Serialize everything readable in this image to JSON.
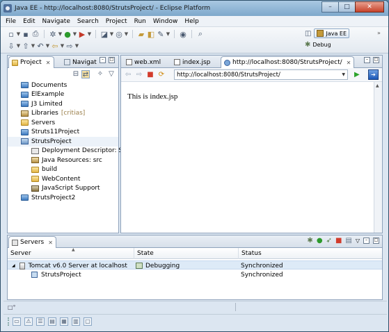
{
  "window": {
    "title": "Java EE - http://localhost:8080/StrutsProject/ - Eclipse Platform",
    "minimize": "–",
    "maximize": "□",
    "close": "✕"
  },
  "menu": [
    "File",
    "Edit",
    "Navigate",
    "Search",
    "Project",
    "Run",
    "Window",
    "Help"
  ],
  "perspectives": {
    "active_label": "Java EE",
    "other_label": "Debug",
    "overflow": "»"
  },
  "project_explorer": {
    "tabs": [
      {
        "label": "Project",
        "icon": "project-explorer-icon"
      },
      {
        "label": "Navigat",
        "icon": "navigator-icon"
      }
    ],
    "items": [
      {
        "label": "Documents",
        "icon": "folder-blue",
        "indent": 0
      },
      {
        "label": "ElExample",
        "icon": "folder-blue",
        "indent": 0
      },
      {
        "label": "J3 Limited",
        "icon": "folder-blue",
        "indent": 0
      },
      {
        "label": "Libraries",
        "suffix": "[critias]",
        "icon": "jar",
        "indent": 0
      },
      {
        "label": "Servers",
        "icon": "folder-yellow",
        "indent": 0
      },
      {
        "label": "Struts11Project",
        "icon": "folder-blue",
        "indent": 0
      },
      {
        "label": "StrutsProject",
        "icon": "proj-ico",
        "indent": 0,
        "selected": true
      },
      {
        "label": "Deployment Descriptor: Stru",
        "icon": "dd-ico",
        "indent": 1
      },
      {
        "label": "Java Resources: src",
        "icon": "jar",
        "indent": 1
      },
      {
        "label": "build",
        "icon": "folder-yellow",
        "indent": 1
      },
      {
        "label": "WebContent",
        "icon": "folder-yellow",
        "indent": 1
      },
      {
        "label": "JavaScript Support",
        "icon": "js-ico",
        "indent": 1
      },
      {
        "label": "StrutsProject2",
        "icon": "folder-blue",
        "indent": 0
      }
    ]
  },
  "editor": {
    "tabs": [
      {
        "label": "web.xml",
        "icon": "xml-file-icon"
      },
      {
        "label": "index.jsp",
        "icon": "jsp-file-icon"
      },
      {
        "label": "http://localhost:8080/StrutsProject/",
        "icon": "browser-icon",
        "active": true
      }
    ],
    "url": "http://localhost:8080/StrutsProject/",
    "content": "This is index.jsp"
  },
  "servers": {
    "tab": "Servers",
    "columns": [
      "Server",
      "State",
      "Status"
    ],
    "rows": [
      {
        "server": "Tomcat v6.0 Server at localhost",
        "state": "Debugging",
        "status": "Synchronized",
        "expanded": true
      },
      {
        "server": "StrutsProject",
        "state": "",
        "status": "Synchronized",
        "child": true
      }
    ]
  },
  "statusbar": {
    "left": "□°"
  }
}
